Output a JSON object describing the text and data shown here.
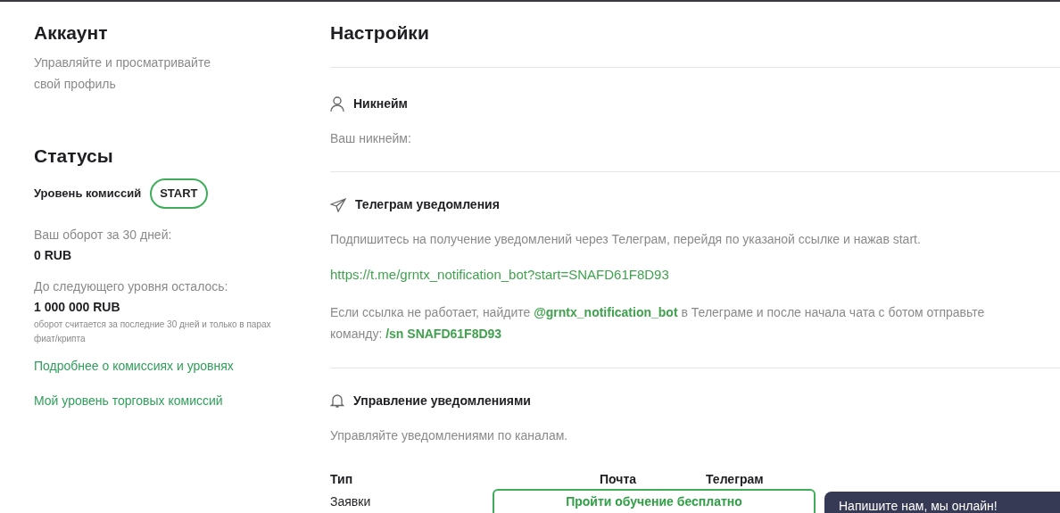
{
  "account": {
    "title": "Аккаунт",
    "subtitle": "Управляйте и просматривайте свой профиль"
  },
  "statuses": {
    "title": "Статусы",
    "level_label": "Уровень комиссий",
    "level_badge": "START",
    "turnover_label": "Ваш оборот за 30 дней:",
    "turnover_value": "0 RUB",
    "next_label": "До следующего уровня осталось:",
    "next_value": "1 000 000 RUB",
    "note": "оборот считается за последние 30 дней и только в парах фиат/крипта",
    "links": [
      "Подробнее о комиссиях и уровнях",
      "Мой уровень торговых комиссий"
    ]
  },
  "settings": {
    "title": "Настройки",
    "nickname": {
      "heading": "Никнейм",
      "label": "Ваш никнейм:"
    },
    "telegram": {
      "heading": "Телеграм уведомления",
      "text": "Подпишитесь на получение уведомлений через Телеграм, перейдя по указаной ссылке и нажав start.",
      "link": "https://t.me/grntx_notification_bot?start=SNAFD61F8D93",
      "help": "Если ссылка не работает, найдите **@grntx_notification_bot** в Телеграме и после начала чата с ботом отправьте команду: **/sn SNAFD61F8D93**"
    },
    "notifications": {
      "heading": "Управление уведомлениями",
      "text": "Управляйте уведомлениями по каналам.",
      "columns": [
        "Тип",
        "Почта",
        "Телеграм"
      ],
      "rows": [
        {
          "type": "Заявки"
        }
      ]
    }
  },
  "training_button": "Пройти обучение бесплатно",
  "chat_bubble": "Напишите нам, мы онлайн!"
}
